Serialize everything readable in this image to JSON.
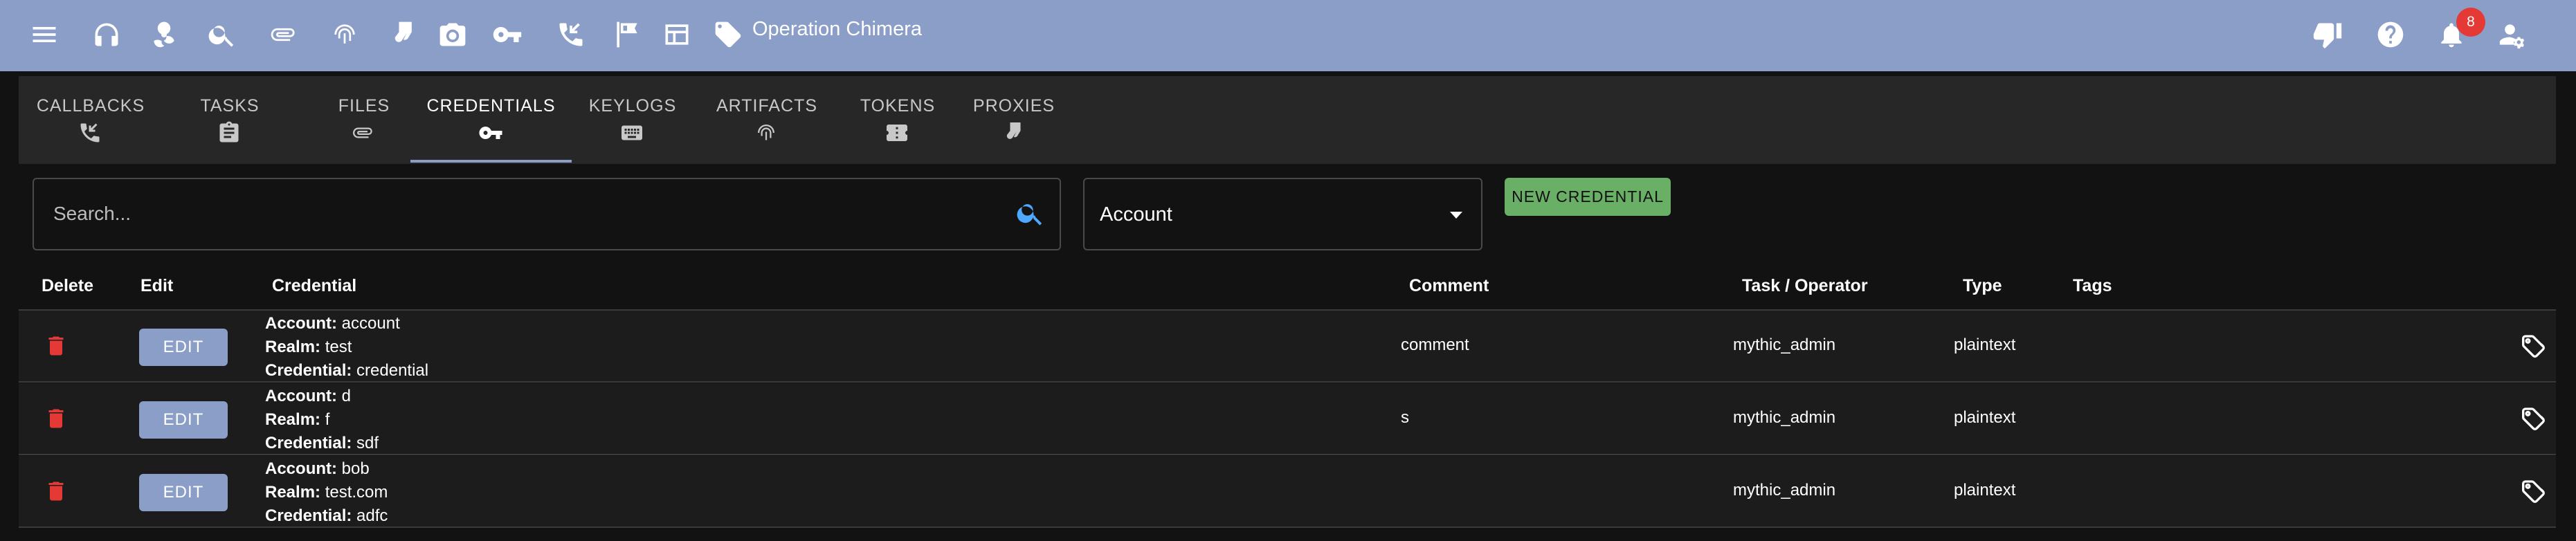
{
  "topbar": {
    "operation_title": "Operation Chimera",
    "notification_count": "8",
    "icons": [
      "menu-icon",
      "headphones-icon",
      "biohazard-icon",
      "search-icon",
      "paperclip-icon",
      "fingerprint-icon",
      "socks-icon",
      "camera-icon",
      "key-icon",
      "phone-callback-icon",
      "flag-icon",
      "table-icon",
      "tag-icon",
      "thumb-down-icon",
      "help-icon",
      "bell-icon",
      "user-settings-icon"
    ]
  },
  "tabs": [
    {
      "label": "CALLBACKS",
      "icon": "phone-callback-icon"
    },
    {
      "label": "TASKS",
      "icon": "clipboard-icon"
    },
    {
      "label": "FILES",
      "icon": "paperclip-icon"
    },
    {
      "label": "CREDENTIALS",
      "icon": "key-icon"
    },
    {
      "label": "KEYLOGS",
      "icon": "keyboard-icon"
    },
    {
      "label": "ARTIFACTS",
      "icon": "fingerprint-icon"
    },
    {
      "label": "TOKENS",
      "icon": "ticket-icon"
    },
    {
      "label": "PROXIES",
      "icon": "socks-icon"
    }
  ],
  "active_tab": "CREDENTIALS",
  "search": {
    "placeholder": "Search..."
  },
  "filter_select": {
    "value": "Account"
  },
  "new_credential_label": "NEW CREDENTIAL",
  "table": {
    "headers": {
      "delete": "Delete",
      "edit": "Edit",
      "credential": "Credential",
      "comment": "Comment",
      "task_operator": "Task / Operator",
      "type": "Type",
      "tags": "Tags"
    },
    "field_labels": {
      "account": "Account:",
      "realm": "Realm:",
      "credential": "Credential:"
    },
    "edit_label": "EDIT",
    "rows": [
      {
        "account": "account",
        "realm": "test",
        "credential": "credential",
        "comment": "comment",
        "operator": "mythic_admin",
        "type": "plaintext"
      },
      {
        "account": "d",
        "realm": "f",
        "credential": "sdf",
        "comment": "s",
        "operator": "mythic_admin",
        "type": "plaintext"
      },
      {
        "account": "bob",
        "realm": "test.com",
        "credential": "adfc",
        "comment": "",
        "operator": "mythic_admin",
        "type": "plaintext"
      }
    ]
  },
  "colors": {
    "topbar": "#8b9ec8",
    "delete": "#e53935",
    "new_button": "#6aaf66",
    "search_icon": "#4fa8ff"
  }
}
